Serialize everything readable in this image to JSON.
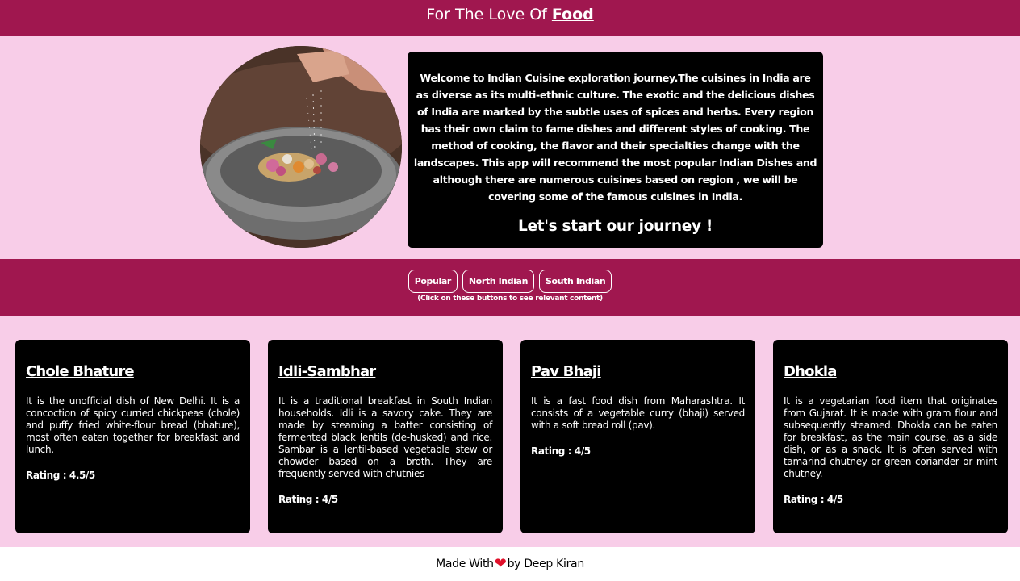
{
  "header": {
    "title_prefix": "For The Love Of",
    "title_highlight": "Food"
  },
  "hero": {
    "image_icon": "spice-bowl-photo",
    "intro_text": "Welcome to Indian Cuisine exploration journey.The cuisines in India are as diverse as its multi-ethnic culture. The exotic and the delicious dishes of India are marked by the subtle uses of spices and herbs. Every region has their own claim to fame dishes and different styles of cooking. The method of cooking, the flavor and their specialties change with the landscapes. This app will recommend the most popular Indian Dishes and although there are numerous cuisines based on region , we will be covering some of the famous cuisines in India.",
    "cta": "Let's start our journey !"
  },
  "nav": {
    "buttons": [
      "Popular",
      "North Indian",
      "South Indian"
    ],
    "hint": "(Click on these buttons to see relevant content)"
  },
  "cards": [
    {
      "title": "Chole Bhature",
      "description": "It is the unofficial dish of New Delhi. It is a concoction of spicy curried chickpeas (chole) and puffy fried white-flour bread (bhature), most often eaten together for breakfast and lunch.",
      "rating": "Rating : 4.5/5"
    },
    {
      "title": "Idli-Sambhar",
      "description": "It is a traditional breakfast in South Indian households. Idli is a savory cake. They are made by steaming a batter consisting of fermented black lentils (de-husked) and rice. Sambar is a lentil-based vegetable stew or chowder based on a broth. They are frequently served with chutnies",
      "rating": "Rating : 4/5"
    },
    {
      "title": "Pav Bhaji",
      "description": "It is a fast food dish from Maharashtra. It consists of a vegetable curry (bhaji) served with a soft bread roll (pav).",
      "rating": "Rating : 4/5"
    },
    {
      "title": "Dhokla",
      "description": "It is a vegetarian food item that originates from Gujarat. It is made with gram flour and subsequently steamed. Dhokla can be eaten for breakfast, as the main course, as a side dish, or as a snack. It is often served with tamarind chutney or green coriander or mint chutney.",
      "rating": "Rating : 4/5"
    }
  ],
  "footer": {
    "made_with": "Made With",
    "heart_icon": "heart-icon",
    "by": "by Deep Kiran"
  },
  "colors": {
    "brand": "#a0174f",
    "background_pink": "#f8cde8",
    "card": "#000000",
    "heart": "#e0102a"
  }
}
